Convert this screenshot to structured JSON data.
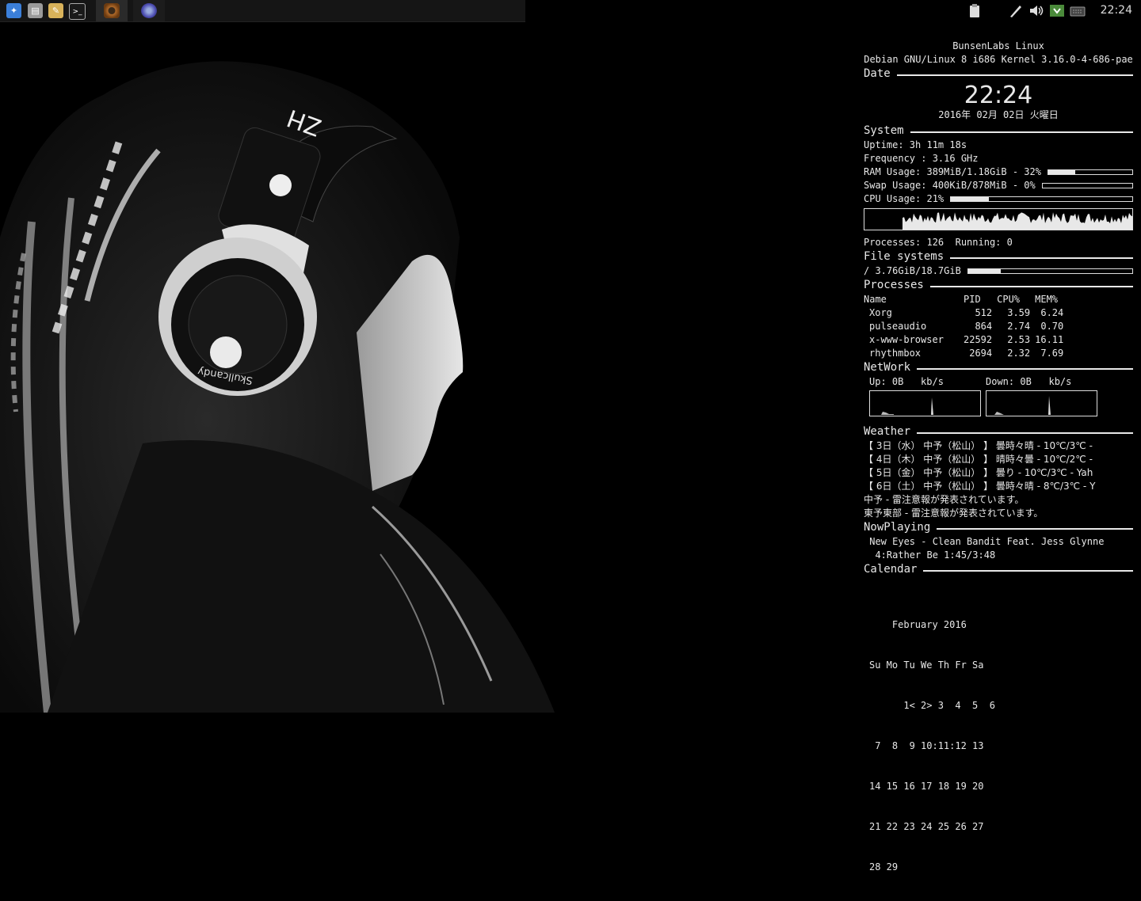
{
  "colors": {
    "panel_bg": "#151515",
    "conky_text": "#e8e8e8",
    "background": "#000000"
  },
  "panel": {
    "launchers": [
      {
        "icon": "compass-icon",
        "color": "#3b7fd9",
        "glyph": "✦"
      },
      {
        "icon": "file-manager-icon",
        "color": "#9a9a9a",
        "glyph": "▤"
      },
      {
        "icon": "text-editor-icon",
        "color": "#d8b25a",
        "glyph": "✎"
      },
      {
        "icon": "terminal-icon",
        "color": "#1a1a1a",
        "glyph": ">_"
      }
    ],
    "tasks": [
      {
        "icon": "rhythmbox-icon",
        "color": "#b06a2a"
      },
      {
        "icon": "browser-icon",
        "color": "#4a4ab0"
      }
    ],
    "tray": [
      "clipboard-icon",
      "pen-icon",
      "volume-icon",
      "network-icon",
      "keyboard-icon"
    ],
    "clock": "22:24"
  },
  "conky": {
    "header": {
      "distro": "BunsenLabs Linux",
      "kernel": "Debian GNU/Linux 8 i686 Kernel 3.16.0-4-686-pae"
    },
    "date": {
      "title": "Date",
      "time": "22:24",
      "date": "2016年 02月 02日 火曜日"
    },
    "system": {
      "title": "System",
      "uptime": "Uptime: 3h 11m 18s",
      "frequency": "Frequency : 3.16 GHz",
      "ram": "RAM Usage: 389MiB/1.18GiB - 32%",
      "ram_pct": 32,
      "swap": "Swap Usage: 400KiB/878MiB - 0%",
      "swap_pct": 0,
      "cpu": "CPU Usage: 21%",
      "cpu_pct": 21,
      "processes": "Processes: 126  Running: 0"
    },
    "filesystems": {
      "title": "File systems",
      "root": "/ 3.76GiB/18.7GiB",
      "root_pct": 20
    },
    "processes": {
      "title": "Processes",
      "headers": [
        "Name",
        "PID",
        "CPU%",
        "MEM%"
      ],
      "rows": [
        [
          "Xorg",
          "512",
          "3.59",
          "6.24"
        ],
        [
          "pulseaudio",
          "864",
          "2.74",
          "0.70"
        ],
        [
          "x-www-browser",
          "22592",
          "2.53",
          "16.11"
        ],
        [
          "rhythmbox",
          "2694",
          "2.32",
          "7.69"
        ]
      ]
    },
    "network": {
      "title": "NetWork",
      "up": "Up: 0B   kb/s",
      "down": "Down: 0B   kb/s"
    },
    "weather": {
      "title": "Weather",
      "lines": [
        "【 3日（水） 中予（松山） 】 曇時々晴 - 10℃/3℃ -",
        "【 4日（木） 中予（松山） 】 晴時々曇 - 10℃/2℃ -",
        "【 5日（金） 中予（松山） 】 曇り - 10℃/3℃ - Yah",
        "【 6日（土） 中予（松山） 】 曇時々晴 - 8℃/3℃ - Y",
        "中予 - 雷注意報が発表されています。",
        "東予東部 - 雷注意報が発表されています。"
      ]
    },
    "nowplaying": {
      "title": "NowPlaying",
      "line1": " New Eyes - Clean Bandit Feat. Jess Glynne",
      "line2": "  4:Rather Be 1:45/3:48"
    },
    "calendar": {
      "title": "Calendar",
      "month": "    February 2016",
      "header": "Su Mo Tu We Th Fr Sa",
      "weeks": [
        "      1< 2> 3  4  5  6",
        " 7  8  9 10:11:12 13",
        "14 15 16 17 18 19 20",
        "21 22 23 24 25 26 27",
        "28 29"
      ]
    }
  }
}
